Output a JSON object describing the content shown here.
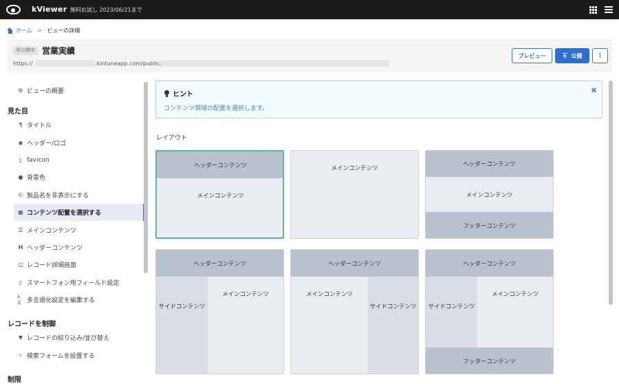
{
  "topbar": {
    "app_title": "kViewer",
    "trial_text": "無料お試し 2023/06/21まで"
  },
  "breadcrumb": {
    "home": "ホーム",
    "separator": ">",
    "current": "ビューの詳細"
  },
  "header": {
    "status_badge": "非公開中",
    "title": "営業実績",
    "url_prefix": "https://",
    "url_mid": ".kintoneapp.com/public/",
    "preview_label": "プレビュー",
    "publish_label": "公開",
    "more_label": "⋮"
  },
  "sidebar": {
    "overview": "ビューの概要",
    "section_appearance": "見た目",
    "items": [
      {
        "label": "タイトル",
        "icon": "paragraph-icon"
      },
      {
        "label": "ヘッダー/ロゴ",
        "icon": "eye-icon"
      },
      {
        "label": "favicon",
        "icon": "bookmark-icon"
      },
      {
        "label": "背景色",
        "icon": "drop-icon"
      },
      {
        "label": "製品名を非表示にする",
        "icon": "copyright-icon"
      },
      {
        "label": "コンテンツ配置を選択する",
        "icon": "layout-grid-icon",
        "active": true
      },
      {
        "label": "メインコンテンツ",
        "icon": "list-icon"
      },
      {
        "label": "ヘッダーコンテンツ",
        "icon": "heading-icon"
      },
      {
        "label": "レコード詳細画面",
        "icon": "window-icon"
      },
      {
        "label": "スマートフォン用フィールド設定",
        "icon": "phone-icon"
      },
      {
        "label": "多言語化設定を編集する",
        "icon": "language-icon"
      }
    ],
    "section_record": "レコードを制御",
    "record_items": [
      {
        "label": "レコードの絞り込み/並び替え",
        "icon": "filter-icon"
      },
      {
        "label": "検索フォームを設置する",
        "icon": "search-icon"
      }
    ],
    "section_limit": "制限"
  },
  "hint": {
    "title": "ヒント",
    "body": "コンテンツ領域の配置を選択します。",
    "close": "✖"
  },
  "layout": {
    "label": "レイアウト",
    "header": "ヘッダーコンテンツ",
    "main": "メインコンテンツ",
    "footer": "フッターコンテンツ",
    "side": "サイドコンテンツ"
  },
  "colors": {
    "accent": "#2f6fd0",
    "selected_border": "#59b8a4",
    "header_segment": "#b8c1ce",
    "side_segment": "#d8dde6"
  }
}
